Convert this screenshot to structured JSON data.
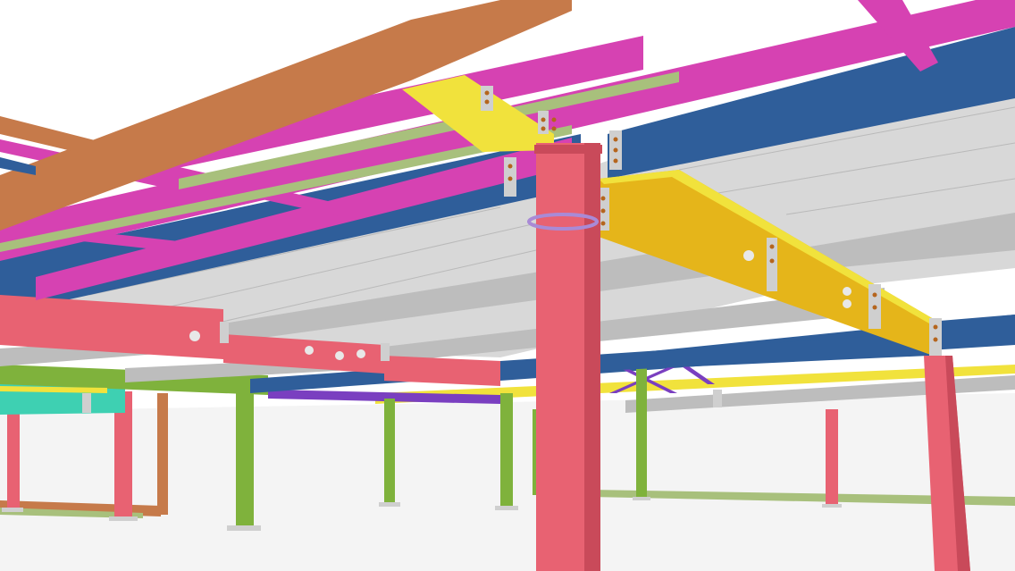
{
  "scene": {
    "colors": {
      "background": "#ffffff",
      "ground": "#f4f4f4",
      "orange_beam": "#c67a4a",
      "magenta_beam": "#d642b2",
      "olive_beam": "#a8c07c",
      "blue_girder": "#2f5e9a",
      "yellow_girder": "#e5b51a",
      "bright_yellow": "#f1e23c",
      "grey_deck": "#d8d8d8",
      "grey_beam": "#bdbdbd",
      "pink_column": "#e86272",
      "green_column": "#7fb23c",
      "purple_brace": "#7a3fc0",
      "teal_panel": "#3ed0b2",
      "bolt": "#b5651d",
      "connection_plate": "#cfcfcf"
    },
    "components": [
      "orange-beam-icon",
      "magenta-joist-icon",
      "blue-girder-icon",
      "yellow-girder-icon",
      "red-beam-icon",
      "grey-deck-icon",
      "pink-column-icon",
      "green-column-icon",
      "purple-brace-icon",
      "base-plate-icon"
    ]
  }
}
